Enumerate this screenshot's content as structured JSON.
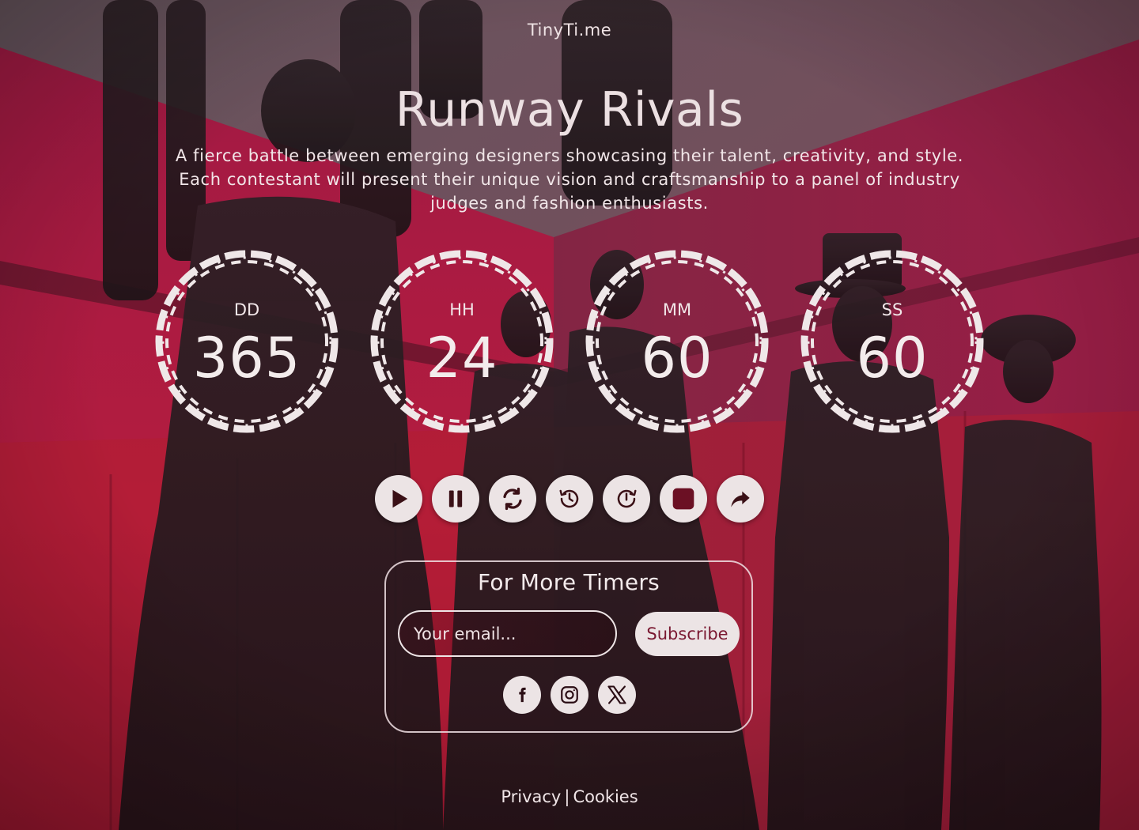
{
  "brand": "TinyTi.me",
  "event": {
    "title": "Runway Rivals",
    "description": "A  fierce battle between emerging designers showcasing their talent, creativity, and style. Each contestant will present their unique vision and craftsmanship to a panel of industry judges and fashion enthusiasts."
  },
  "countdown": [
    {
      "unit": "DD",
      "value": "365"
    },
    {
      "unit": "HH",
      "value": "24"
    },
    {
      "unit": "MM",
      "value": "60"
    },
    {
      "unit": "SS",
      "value": "60"
    }
  ],
  "controls": [
    {
      "icon": "play-icon"
    },
    {
      "icon": "pause-icon"
    },
    {
      "icon": "refresh-icon"
    },
    {
      "icon": "history-icon"
    },
    {
      "icon": "timer-reset-icon"
    },
    {
      "icon": "stop-icon"
    },
    {
      "icon": "share-icon"
    }
  ],
  "subscribe": {
    "title": "For More Timers",
    "email_placeholder": "Your email...",
    "button_label": "Subscribe",
    "socials": [
      {
        "icon": "facebook-icon"
      },
      {
        "icon": "instagram-icon"
      },
      {
        "icon": "x-icon"
      }
    ]
  },
  "footer": {
    "privacy": "Privacy",
    "separator": "|",
    "cookies": "Cookies"
  },
  "colors": {
    "accent": "#7a1831",
    "dial": "#efe7e8",
    "button_bg": "#ece4e5",
    "overlay": "#c2185b"
  }
}
